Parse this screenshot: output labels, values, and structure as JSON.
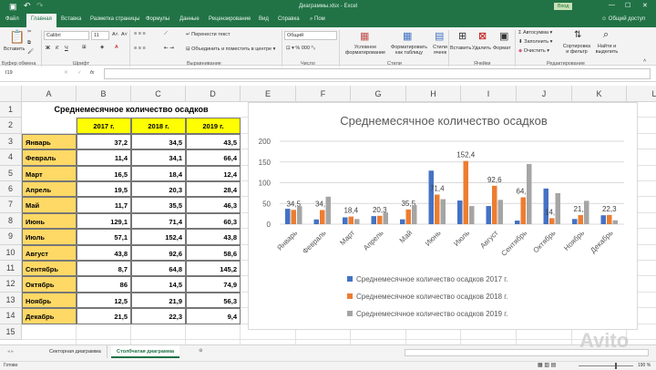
{
  "window": {
    "title": "Диаграммы.xlsx - Excel",
    "login_label": "Вход"
  },
  "ribbon_tabs": [
    "Файл",
    "Главная",
    "Вставка",
    "Разметка страницы",
    "Формулы",
    "Данные",
    "Рецензирование",
    "Вид",
    "Справка",
    "Пом"
  ],
  "share_label": "Общий доступ",
  "ribbon": {
    "paste": "Вставить",
    "clipboard": "Буфер обмена",
    "font_name": "Calibri",
    "font_size": "11",
    "font_group": "Шрифт",
    "bold": "Ж",
    "italic": "К",
    "underline": "Ч",
    "wrap": "Перенести текст",
    "merge": "Объединить и поместить в центре",
    "align_group": "Выравнивание",
    "number_format": "Общий",
    "number_group": "Число",
    "cond_format": "Условное форматирование",
    "format_table": "Форматировать как таблицу",
    "cell_styles": "Стили ячеек",
    "styles_group": "Стили",
    "insert": "Вставить",
    "delete": "Удалить",
    "format": "Формат",
    "cells_group": "Ячейки",
    "autosum": "Автосумма",
    "fill": "Заполнить",
    "clear": "Очистить",
    "sort": "Сортировка и фильтр",
    "find": "Найти и выделить",
    "editing_group": "Редактирование"
  },
  "formula_bar": {
    "name_box": "I19",
    "value": ""
  },
  "columns": [
    "A",
    "B",
    "C",
    "D",
    "E",
    "F",
    "G",
    "H",
    "I",
    "J",
    "K",
    "L"
  ],
  "rows": [
    "1",
    "2",
    "3",
    "4",
    "5",
    "6",
    "7",
    "8",
    "9",
    "10",
    "11",
    "12",
    "13",
    "14",
    "15"
  ],
  "table": {
    "title": "Среднемесячное количество осадков",
    "headers": [
      "2017 г.",
      "2018 г.",
      "2019 г."
    ],
    "rows": [
      [
        "Январь",
        "37,2",
        "34,5",
        "43,5"
      ],
      [
        "Февраль",
        "11,4",
        "34,1",
        "66,4"
      ],
      [
        "Март",
        "16,5",
        "18,4",
        "12,4"
      ],
      [
        "Апрель",
        "19,5",
        "20,3",
        "28,4"
      ],
      [
        "Май",
        "11,7",
        "35,5",
        "46,3"
      ],
      [
        "Июнь",
        "129,1",
        "71,4",
        "60,3"
      ],
      [
        "Июль",
        "57,1",
        "152,4",
        "43,8"
      ],
      [
        "Август",
        "43,8",
        "92,6",
        "58,6"
      ],
      [
        "Сентябрь",
        "8,7",
        "64,8",
        "145,2"
      ],
      [
        "Октябрь",
        "86",
        "14,5",
        "74,9"
      ],
      [
        "Ноябрь",
        "12,5",
        "21,9",
        "56,3"
      ],
      [
        "Декабрь",
        "21,5",
        "22,3",
        "9,4"
      ]
    ]
  },
  "chart_data": {
    "type": "bar",
    "title": "Среднемесячное количество осадков",
    "categories": [
      "Январь",
      "Февраль",
      "Март",
      "Апрель",
      "Май",
      "Июнь",
      "Июль",
      "Август",
      "Сентябрь",
      "Октябрь",
      "Ноябрь",
      "Декабрь"
    ],
    "series": [
      {
        "name": "Среднемесячное количество осадков 2017 г.",
        "color": "#4472c4",
        "values": [
          37.2,
          11.4,
          16.5,
          19.5,
          11.7,
          129.1,
          57.1,
          43.8,
          8.7,
          86,
          12.5,
          21.5
        ]
      },
      {
        "name": "Среднемесячное количество осадков 2018 г.",
        "color": "#ed7d31",
        "values": [
          34.5,
          34.1,
          18.4,
          20.3,
          35.5,
          71.4,
          152.4,
          92.6,
          64.8,
          14.5,
          21.9,
          22.3
        ],
        "data_labels": [
          "34,5",
          "34,1",
          "18,4",
          "20,3",
          "35,5",
          "71,4",
          "152,4",
          "92,6",
          "64,8",
          "14,5",
          "21,9",
          "22,3"
        ]
      },
      {
        "name": "Среднемесячное количество осадков 2019 г.",
        "color": "#a5a5a5",
        "values": [
          43.5,
          66.4,
          12.4,
          28.4,
          46.3,
          60.3,
          43.8,
          58.6,
          145.2,
          74.9,
          56.3,
          9.4
        ]
      }
    ],
    "yticks": [
      "0",
      "50",
      "100",
      "150",
      "200"
    ],
    "ylim": [
      0,
      200
    ],
    "grid": true,
    "legend": "bottom"
  },
  "sheets": [
    "Секторная диаграмма",
    "Столбчатая диаграмма"
  ],
  "active_sheet": 1,
  "status": {
    "ready": "Готово",
    "zoom": "190 %"
  },
  "watermark": "Avito"
}
